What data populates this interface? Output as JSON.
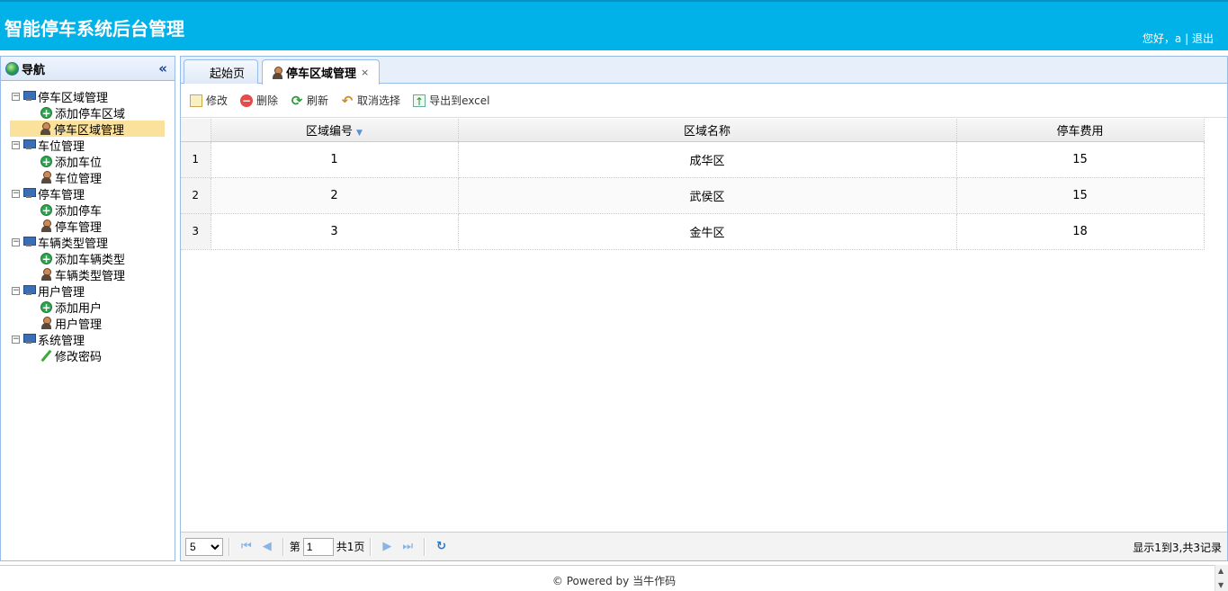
{
  "header": {
    "title": "智能停车系统后台管理",
    "greeting": "您好，a",
    "separator": "|",
    "logout": "退出"
  },
  "sidebar": {
    "title": "导航",
    "collapse_icon": "double-chevron-left-icon",
    "groups": [
      {
        "label": "停车区域管理",
        "items": [
          {
            "label": "添加停车区域",
            "icon": "add-icon"
          },
          {
            "label": "停车区域管理",
            "icon": "user-icon",
            "selected": true
          }
        ]
      },
      {
        "label": "车位管理",
        "items": [
          {
            "label": "添加车位",
            "icon": "add-icon"
          },
          {
            "label": "车位管理",
            "icon": "user-icon"
          }
        ]
      },
      {
        "label": "停车管理",
        "items": [
          {
            "label": "添加停车",
            "icon": "add-icon"
          },
          {
            "label": "停车管理",
            "icon": "user-icon"
          }
        ]
      },
      {
        "label": "车辆类型管理",
        "items": [
          {
            "label": "添加车辆类型",
            "icon": "add-icon"
          },
          {
            "label": "车辆类型管理",
            "icon": "user-icon"
          }
        ]
      },
      {
        "label": "用户管理",
        "items": [
          {
            "label": "添加用户",
            "icon": "add-icon"
          },
          {
            "label": "用户管理",
            "icon": "user-icon"
          }
        ]
      },
      {
        "label": "系统管理",
        "items": [
          {
            "label": "修改密码",
            "icon": "pencil-icon"
          }
        ]
      }
    ]
  },
  "tabs": [
    {
      "label": "起始页",
      "active": false
    },
    {
      "label": "停车区域管理",
      "active": true,
      "close": "×"
    }
  ],
  "toolbar": {
    "edit": "修改",
    "delete": "删除",
    "refresh": "刷新",
    "unselect": "取消选择",
    "export": "导出到excel"
  },
  "grid": {
    "columns": [
      "区域编号",
      "区域名称",
      "停车费用"
    ],
    "rows": [
      {
        "rownum": "1",
        "id": "1",
        "name": "成华区",
        "fee": "15"
      },
      {
        "rownum": "2",
        "id": "2",
        "name": "武侯区",
        "fee": "15"
      },
      {
        "rownum": "3",
        "id": "3",
        "name": "金牛区",
        "fee": "18"
      }
    ]
  },
  "pager": {
    "page_size": "5",
    "page_prefix": "第",
    "page_value": "1",
    "page_total": "共1页",
    "info": "显示1到3,共3记录"
  },
  "footer": {
    "text": "© Powered by 当牛作码"
  },
  "colors": {
    "header_bg": "#00b2e7",
    "selected_row": "#fbe29c",
    "panel_border": "#99bbe8"
  }
}
